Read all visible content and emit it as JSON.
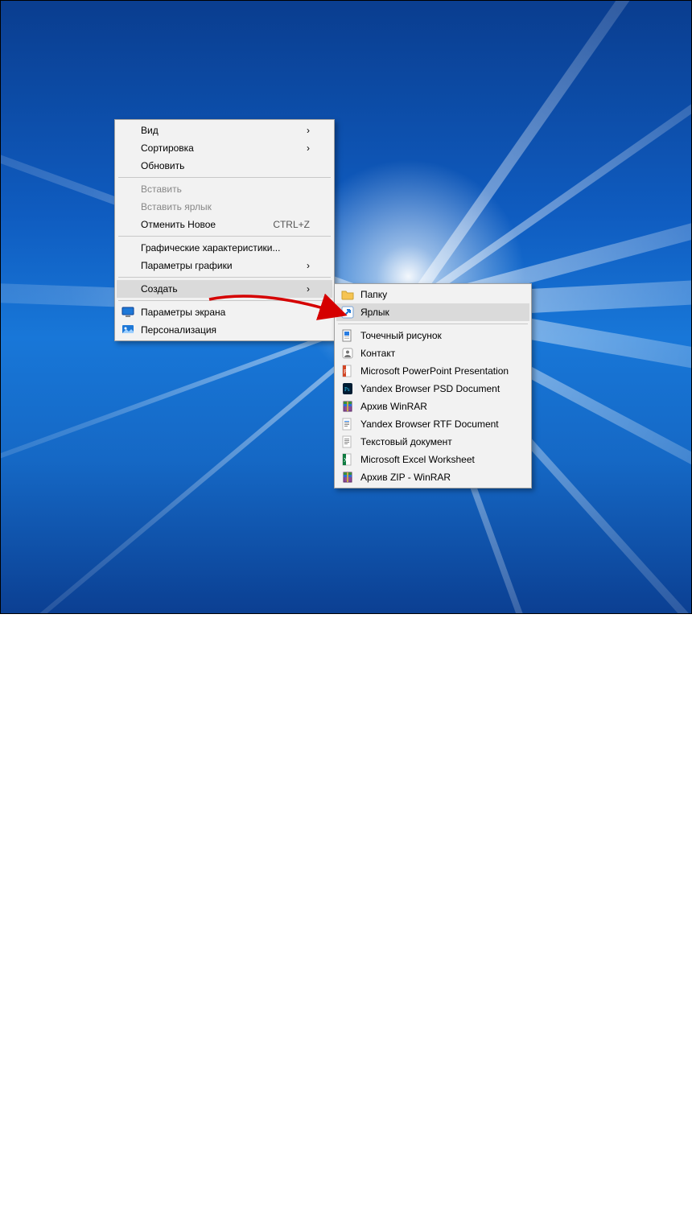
{
  "mainMenu": {
    "items": [
      {
        "label": "Вид",
        "submenu": true,
        "disabled": false,
        "icon": null
      },
      {
        "label": "Сортировка",
        "submenu": true,
        "disabled": false,
        "icon": null
      },
      {
        "label": "Обновить",
        "submenu": false,
        "disabled": false,
        "icon": null
      },
      {
        "sep": true
      },
      {
        "label": "Вставить",
        "submenu": false,
        "disabled": true,
        "icon": null
      },
      {
        "label": "Вставить ярлык",
        "submenu": false,
        "disabled": true,
        "icon": null
      },
      {
        "label": "Отменить Новое",
        "submenu": false,
        "disabled": false,
        "icon": null,
        "accel": "CTRL+Z"
      },
      {
        "sep": true
      },
      {
        "label": "Графические характеристики...",
        "submenu": false,
        "disabled": false,
        "icon": null
      },
      {
        "label": "Параметры графики",
        "submenu": true,
        "disabled": false,
        "icon": null
      },
      {
        "sep": true
      },
      {
        "label": "Создать",
        "submenu": true,
        "disabled": false,
        "icon": null,
        "hover": true
      },
      {
        "sep": true
      },
      {
        "label": "Параметры экрана",
        "submenu": false,
        "disabled": false,
        "icon": "display"
      },
      {
        "label": "Персонализация",
        "submenu": false,
        "disabled": false,
        "icon": "personalize"
      }
    ]
  },
  "subMenu": {
    "items": [
      {
        "label": "Папку",
        "icon": "folder"
      },
      {
        "label": "Ярлык",
        "icon": "shortcut",
        "hover": true
      },
      {
        "sep": true
      },
      {
        "label": "Точечный рисунок",
        "icon": "bitmap"
      },
      {
        "label": "Контакт",
        "icon": "contact"
      },
      {
        "label": "Microsoft PowerPoint Presentation",
        "icon": "pptx"
      },
      {
        "label": "Yandex Browser PSD Document",
        "icon": "psd"
      },
      {
        "label": "Архив WinRAR",
        "icon": "rar"
      },
      {
        "label": "Yandex Browser RTF Document",
        "icon": "rtf"
      },
      {
        "label": "Текстовый документ",
        "icon": "txt"
      },
      {
        "label": "Microsoft Excel Worksheet",
        "icon": "xlsx"
      },
      {
        "label": "Архив ZIP - WinRAR",
        "icon": "zip"
      }
    ]
  },
  "annotation": {
    "color": "#d50000"
  }
}
